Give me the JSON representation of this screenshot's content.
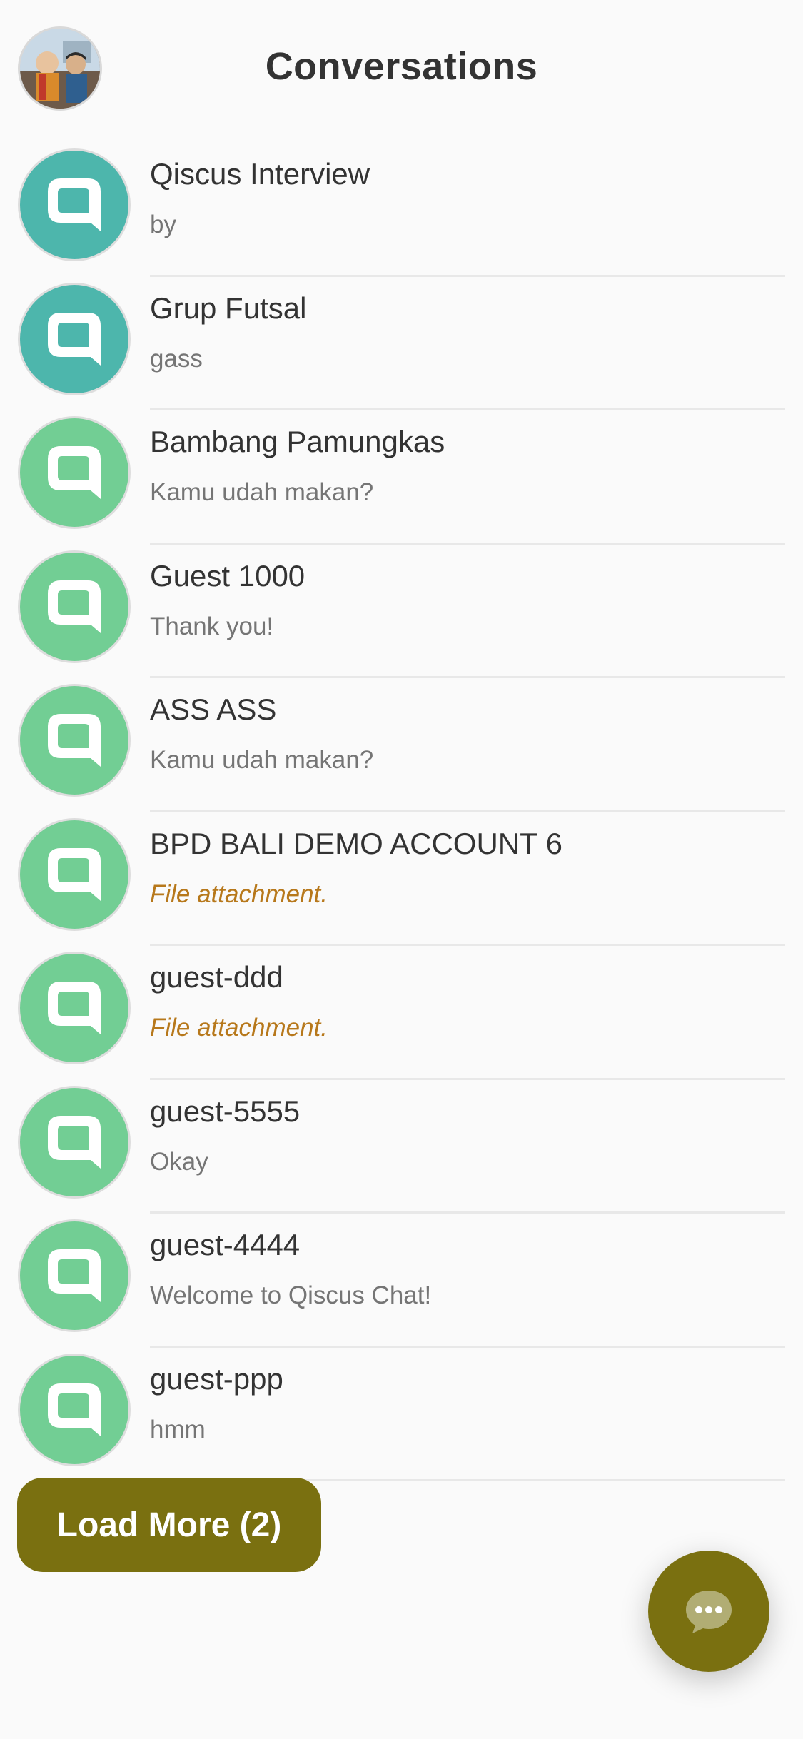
{
  "header": {
    "title": "Conversations",
    "avatar_icon": "profile-avatar"
  },
  "conversations": [
    {
      "name": "Qiscus Interview",
      "preview": "by",
      "avatar_color": "#4db6ac",
      "is_attachment": false
    },
    {
      "name": "Grup Futsal",
      "preview": "gass",
      "avatar_color": "#4db6ac",
      "is_attachment": false
    },
    {
      "name": "Bambang Pamungkas",
      "preview": "Kamu udah makan?",
      "avatar_color": "#72ce94",
      "is_attachment": false
    },
    {
      "name": "Guest 1000",
      "preview": "Thank you!",
      "avatar_color": "#72ce94",
      "is_attachment": false
    },
    {
      "name": "ASS ASS",
      "preview": "Kamu udah makan?",
      "avatar_color": "#72ce94",
      "is_attachment": false
    },
    {
      "name": "BPD BALI DEMO ACCOUNT 6",
      "preview": "File attachment.",
      "avatar_color": "#72ce94",
      "is_attachment": true
    },
    {
      "name": "guest-ddd",
      "preview": "File attachment.",
      "avatar_color": "#72ce94",
      "is_attachment": true
    },
    {
      "name": "guest-5555",
      "preview": "Okay",
      "avatar_color": "#72ce94",
      "is_attachment": false
    },
    {
      "name": "guest-4444",
      "preview": "Welcome to Qiscus Chat!",
      "avatar_color": "#72ce94",
      "is_attachment": false
    },
    {
      "name": "guest-ppp",
      "preview": "hmm",
      "avatar_color": "#72ce94",
      "is_attachment": false
    }
  ],
  "load_more": {
    "label": "Load More (2)"
  },
  "fab": {
    "icon": "chat-bubble-icon"
  },
  "colors": {
    "accent": "#7a7010",
    "attachment_text": "#b7781b",
    "teal_avatar": "#4db6ac",
    "green_avatar": "#72ce94"
  }
}
